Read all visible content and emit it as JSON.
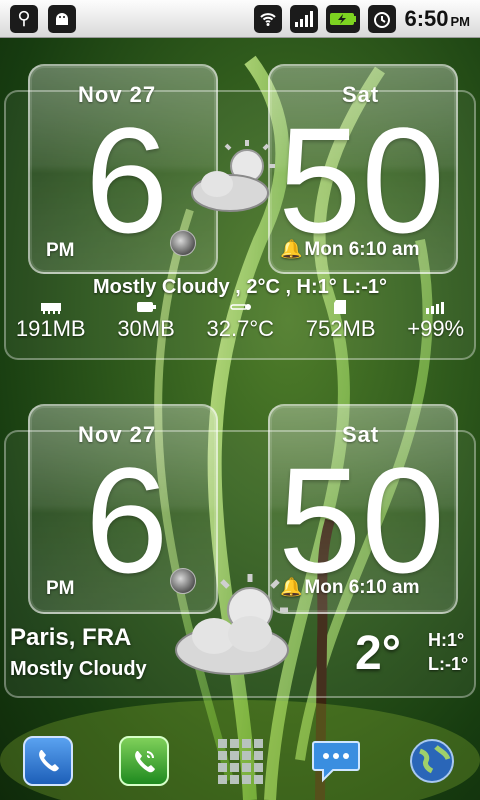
{
  "status_bar": {
    "left_icons": [
      "usb-icon",
      "android-debug-icon"
    ],
    "right_icons": [
      "wifi-icon",
      "signal-icon",
      "battery-charging-icon",
      "alarm-clock-icon"
    ],
    "time": "6:50",
    "ampm": "PM"
  },
  "clock_widget": {
    "date": "Nov  27",
    "day": "Sat",
    "hour": "6",
    "minute": "50",
    "ampm": "PM",
    "alarm": "Mon 6:10 am",
    "weather_summary": "Mostly Cloudy , 2°C , H:1° L:-1°",
    "stats": [
      {
        "icon": "ram-icon",
        "value": "191MB"
      },
      {
        "icon": "battery-icon",
        "value": "30MB"
      },
      {
        "icon": "thermometer-icon",
        "value": "32.7°C"
      },
      {
        "icon": "sd-card-icon",
        "value": "752MB"
      },
      {
        "icon": "battery-level-icon",
        "value": "+99%"
      }
    ]
  },
  "weather_widget": {
    "date": "Nov  27",
    "day": "Sat",
    "hour": "6",
    "minute": "50",
    "ampm": "PM",
    "alarm": "Mon 6:10 am",
    "city": "Paris, FRA",
    "condition": "Mostly Cloudy",
    "temperature": "2°",
    "high": "H:1°",
    "low": "L:-1°"
  },
  "dock": [
    {
      "name": "phone-icon",
      "color": "#2b6fd0"
    },
    {
      "name": "dialer-icon",
      "color": "#2e9a2e"
    },
    {
      "name": "app-drawer-icon",
      "color": "#9aa5a0"
    },
    {
      "name": "messaging-icon",
      "color": "#3a8ee0"
    },
    {
      "name": "browser-globe-icon",
      "color": "#2a66b8"
    }
  ]
}
